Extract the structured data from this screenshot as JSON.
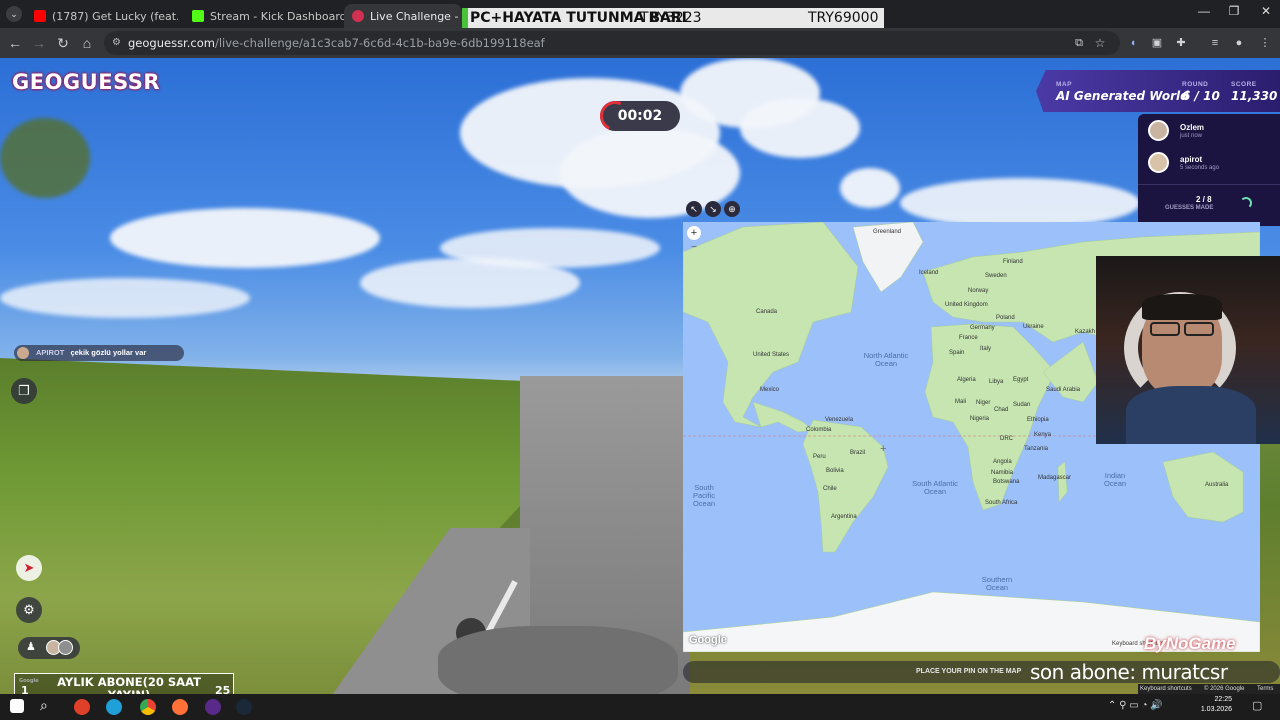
{
  "browser": {
    "tabs": [
      {
        "title": "(1787) Get Lucky (feat. Pha",
        "active": false,
        "fav_color": "#ff0000"
      },
      {
        "title": "Stream - Kick Dashboard",
        "active": false,
        "fav_color": "#53fc18"
      },
      {
        "title": "Live Challenge - GeoGuessr",
        "active": true,
        "fav_color": "#d13050"
      }
    ],
    "url_host": "geoguessr.com",
    "url_path": "/live-challenge/a1c3cab7-6c6d-4c1b-ba9e-6db199118eaf"
  },
  "ticker": {
    "left_text": "PC+HAYATA TUTUNMA BARI",
    "mid_text": "TRY3223",
    "right_text": "TRY69000"
  },
  "game": {
    "logo": "GEOGUESSR",
    "timer": "00:02",
    "map_label": "MAP",
    "map_value": "AI Generated World",
    "round_label": "ROUND",
    "round_value": "6 / 10",
    "score_label": "SCORE",
    "score_value": "11,330",
    "players": [
      {
        "name": "Ozlem",
        "time": "just now"
      },
      {
        "name": "apirot",
        "time": "5 seconds ago"
      }
    ],
    "guesses_count": "2 / 8",
    "guesses_label": "GUESSES MADE",
    "chat_user": "APIROT",
    "chat_text": "çekik gözlü yollar var",
    "pin_hint": "PLACE YOUR PIN ON THE MAP",
    "pin_status_sub": "son abone: muratcsr"
  },
  "map": {
    "zoom_in": "+",
    "zoom_out": "−",
    "google": "Google",
    "keyboard": "Keyboard shortcuts",
    "copyright": "© 2026 Google",
    "terms": "Terms",
    "labels": [
      "Greenland",
      "Iceland",
      "Finland",
      "Sweden",
      "Norway",
      "United Kingdom",
      "Germany",
      "Poland",
      "Ukraine",
      "Kazakh",
      "France",
      "Spain",
      "Italy",
      "Canada",
      "United States",
      "Mexico",
      "Venezuela",
      "Colombia",
      "Peru",
      "Brazil",
      "Bolivia",
      "Chile",
      "Argentina",
      "Algeria",
      "Libya",
      "Egypt",
      "Saudi Arabia",
      "Mali",
      "Niger",
      "Chad",
      "Sudan",
      "Nigeria",
      "Ethiopia",
      "DRC",
      "Kenya",
      "Tanzania",
      "Angola",
      "Namibia",
      "Botswana",
      "Madagascar",
      "South Africa",
      "Australia"
    ],
    "oceans": [
      "North Atlantic Ocean",
      "South Pacific Ocean",
      "South Atlantic Ocean",
      "Indian Ocean",
      "Southern Ocean"
    ]
  },
  "stream_overlay": {
    "sub_goal_label": "AYLIK ABONE(20 SAAT YAYIN)",
    "sub_goal_current": "1",
    "sub_goal_target": "25",
    "watermark": "ByNoGame"
  },
  "taskbar": {
    "time": "22:25",
    "date": "1.03.2026"
  }
}
